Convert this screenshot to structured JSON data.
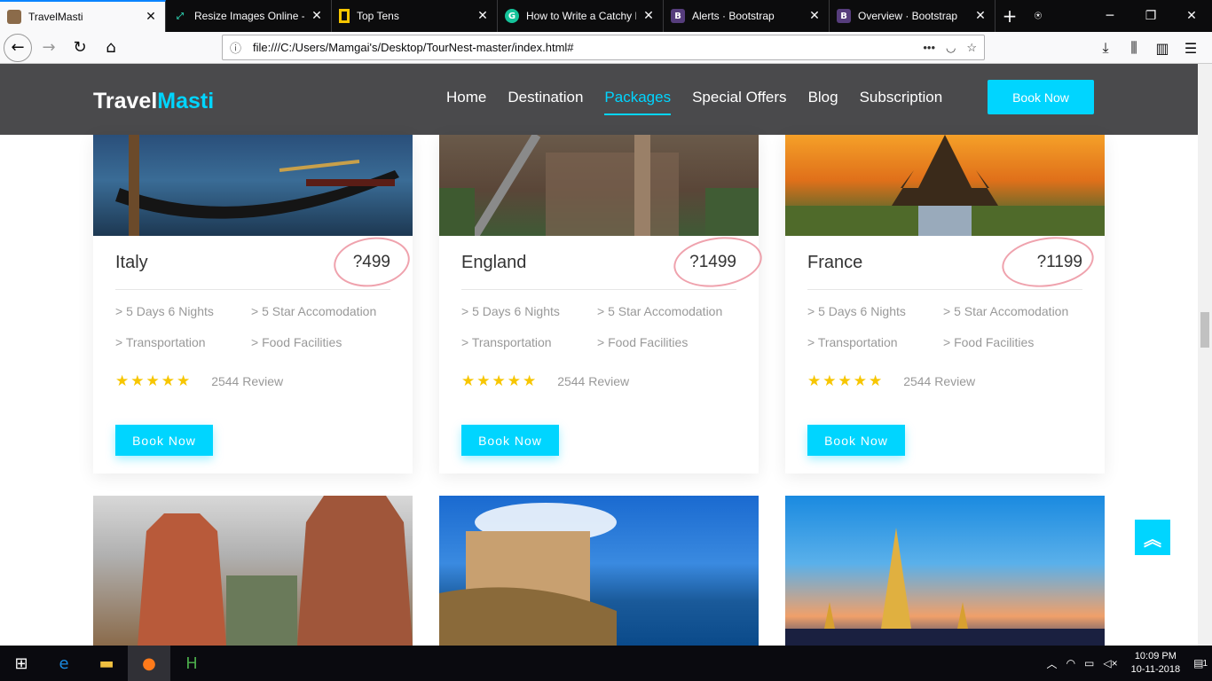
{
  "browser": {
    "tabs": [
      {
        "title": "TravelMasti",
        "icon": "photo-favicon-icon",
        "active": true
      },
      {
        "title": "Resize Images Online - R",
        "icon": "resize-favicon-icon",
        "active": false
      },
      {
        "title": "Top Tens",
        "icon": "nat-geo-favicon-icon",
        "active": false
      },
      {
        "title": "How to Write a Catchy H",
        "icon": "grammarly-favicon-icon",
        "active": false
      },
      {
        "title": "Alerts · Bootstrap",
        "icon": "bootstrap-favicon-icon",
        "active": false
      },
      {
        "title": "Overview · Bootstrap",
        "icon": "bootstrap-favicon-icon",
        "active": false
      }
    ],
    "url": "file:///C:/Users/Mamgai's/Desktop/TourNest-master/index.html#"
  },
  "site": {
    "logo_a": "Travel",
    "logo_b": "Masti",
    "menu": [
      "Home",
      "Destination",
      "Packages",
      "Special Offers",
      "Blog",
      "Subscription"
    ],
    "active_menu": "Packages",
    "book_now": "Book Now"
  },
  "cards": [
    {
      "name": "Italy",
      "price": "?499",
      "f1": "> 5 Days 6 Nights",
      "f2": "> 5 Star Accomodation",
      "f3": "> Transportation",
      "f4": "> Food Facilities",
      "stars": "★★★★★",
      "review": "2544 Review",
      "btn": "Book Now"
    },
    {
      "name": "England",
      "price": "?1499",
      "f1": "> 5 Days 6 Nights",
      "f2": "> 5 Star Accomodation",
      "f3": "> Transportation",
      "f4": "> Food Facilities",
      "stars": "★★★★★",
      "review": "2544 Review",
      "btn": "Book Now"
    },
    {
      "name": "France",
      "price": "?1199",
      "f1": "> 5 Days 6 Nights",
      "f2": "> 5 Star Accomodation",
      "f3": "> Transportation",
      "f4": "> Food Facilities",
      "stars": "★★★★★",
      "review": "2544 Review",
      "btn": "Book Now"
    }
  ],
  "taskbar": {
    "time": "10:09 PM",
    "date": "10-11-2018",
    "notifications": "1"
  },
  "colors": {
    "accent": "#00d5ff",
    "header": "#4a4a4c"
  }
}
